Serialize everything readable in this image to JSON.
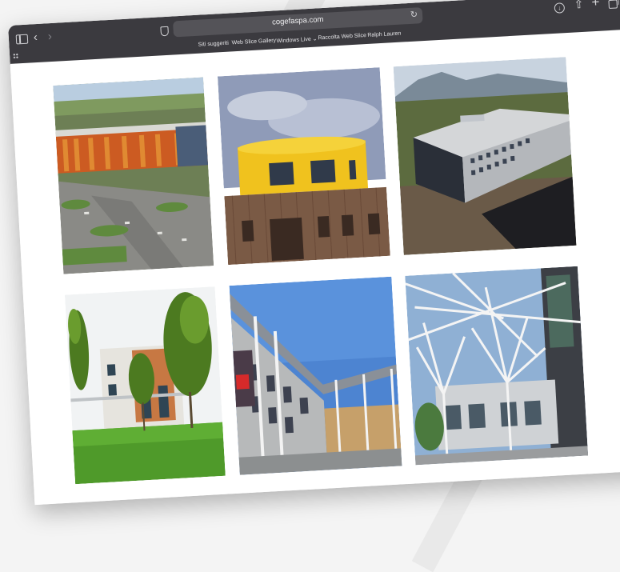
{
  "browser": {
    "url": "cogefaspa.com",
    "favorites": [
      "Siti suggeriti",
      "Web Slice Gallery",
      "Windows Live ⌄",
      "Raccolta Web Slice",
      "Ralph Lauren"
    ]
  },
  "gallery": {
    "images": [
      "aerial-orange-facade-building",
      "yellow-cylinder-wood-building",
      "grey-office-block-mountains",
      "white-building-with-trees",
      "modern-mall-with-canopy",
      "white-tree-column-atrium"
    ]
  },
  "colors": {
    "toolbar": "#3b3a3f",
    "address_bar": "#545358",
    "page_bg": "#ffffff"
  }
}
